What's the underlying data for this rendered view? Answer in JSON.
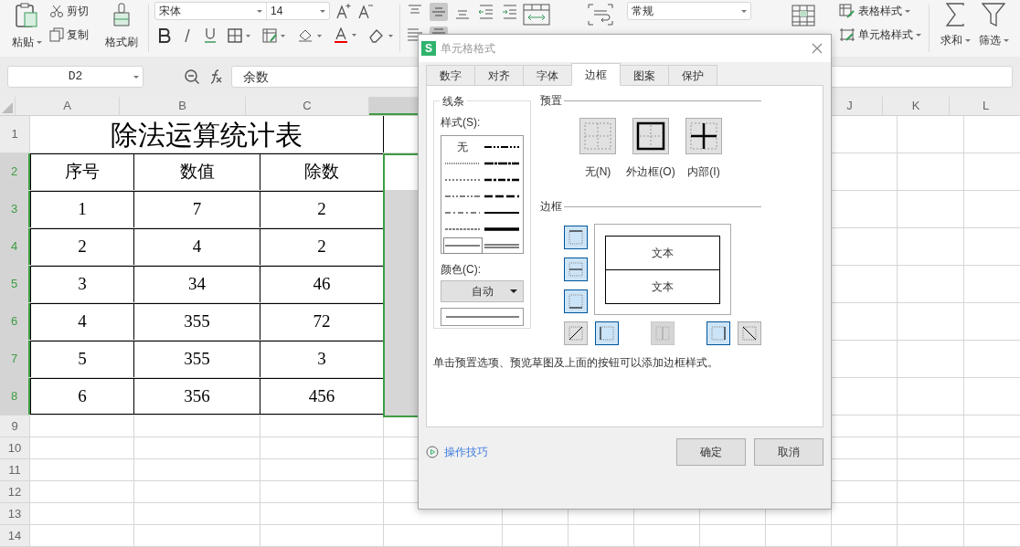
{
  "ribbon": {
    "clipboard": {
      "paste": "粘贴",
      "cut": "剪切",
      "copy": "复制",
      "format_painter": "格式刷"
    },
    "font": {
      "family": "宋体",
      "size": "14"
    },
    "number_format": "常规",
    "styles": {
      "table_style": "表格样式",
      "cell_style": "单元格样式"
    },
    "editing": {
      "sum": "求和",
      "filter": "筛选"
    }
  },
  "formula_bar": {
    "name_box": "D2",
    "formula": "余数"
  },
  "sheet": {
    "columns_left": [
      "A",
      "B",
      "C"
    ],
    "columns_right": [
      "J",
      "K",
      "L"
    ],
    "row_numbers": [
      {
        "label": "1",
        "selected": false
      },
      {
        "label": "2",
        "selected": true
      },
      {
        "label": "3",
        "selected": true
      },
      {
        "label": "4",
        "selected": true
      },
      {
        "label": "5",
        "selected": true
      },
      {
        "label": "6",
        "selected": true
      },
      {
        "label": "7",
        "selected": true
      },
      {
        "label": "8",
        "selected": true
      },
      {
        "label": "9",
        "selected": false
      },
      {
        "label": "10",
        "selected": false
      },
      {
        "label": "11",
        "selected": false
      },
      {
        "label": "12",
        "selected": false
      },
      {
        "label": "13",
        "selected": false
      },
      {
        "label": "14",
        "selected": false
      }
    ],
    "title": "除法运算统计表",
    "header": [
      "序号",
      "数值",
      "除数"
    ],
    "rows": [
      [
        "1",
        "7",
        "2"
      ],
      [
        "2",
        "4",
        "2"
      ],
      [
        "3",
        "34",
        "46"
      ],
      [
        "4",
        "355",
        "72"
      ],
      [
        "5",
        "355",
        "3"
      ],
      [
        "6",
        "356",
        "456"
      ]
    ]
  },
  "dialog": {
    "logo_letter": "S",
    "title": "单元格格式",
    "tabs": [
      {
        "label": "数字",
        "selected": false
      },
      {
        "label": "对齐",
        "selected": false
      },
      {
        "label": "字体",
        "selected": false
      },
      {
        "label": "边框",
        "selected": true
      },
      {
        "label": "图案",
        "selected": false
      },
      {
        "label": "保护",
        "selected": false
      }
    ],
    "line_group": "线条",
    "style_label": "样式(S):",
    "line_styles": [
      {
        "kind": "none",
        "label": "无",
        "selected": false
      },
      {
        "kind": "medium-dash-dot-dot",
        "selected": false
      },
      {
        "kind": "hair",
        "selected": false
      },
      {
        "kind": "slant-dash-dot",
        "selected": false
      },
      {
        "kind": "dotted",
        "selected": false
      },
      {
        "kind": "medium-dash-dot",
        "selected": false
      },
      {
        "kind": "dash-dot-dot",
        "selected": false
      },
      {
        "kind": "medium-dashed",
        "selected": false
      },
      {
        "kind": "dash-dot",
        "selected": false
      },
      {
        "kind": "medium",
        "selected": false
      },
      {
        "kind": "dashed",
        "selected": false
      },
      {
        "kind": "thick",
        "selected": false
      },
      {
        "kind": "thin",
        "selected": true
      },
      {
        "kind": "double",
        "selected": false
      }
    ],
    "color_label": "颜色(C):",
    "color_value": "自动",
    "preset_title": "预置",
    "presets": [
      {
        "kind": "none",
        "label": "无(N)"
      },
      {
        "kind": "outline",
        "label": "外边框(O)"
      },
      {
        "kind": "inside",
        "label": "内部(I)"
      }
    ],
    "border_title": "边框",
    "side_buttons": [
      {
        "kind": "top",
        "on": true,
        "disabled": false
      },
      {
        "kind": "middle",
        "on": true,
        "disabled": false
      },
      {
        "kind": "bottom",
        "on": true,
        "disabled": false
      }
    ],
    "bottom_buttons": [
      {
        "kind": "diag-up",
        "on": false,
        "disabled": false
      },
      {
        "kind": "left",
        "on": true,
        "disabled": false
      },
      {
        "kind": "vertical",
        "on": false,
        "disabled": true
      },
      {
        "kind": "right",
        "on": true,
        "disabled": false
      },
      {
        "kind": "diag-down",
        "on": false,
        "disabled": false
      }
    ],
    "preview_texts": [
      "文本",
      "文本"
    ],
    "hint": "单击预置选项、预览草图及上面的按钮可以添加边框样式。",
    "tips_link": "操作技巧",
    "buttons": [
      "确定",
      "取消"
    ]
  }
}
